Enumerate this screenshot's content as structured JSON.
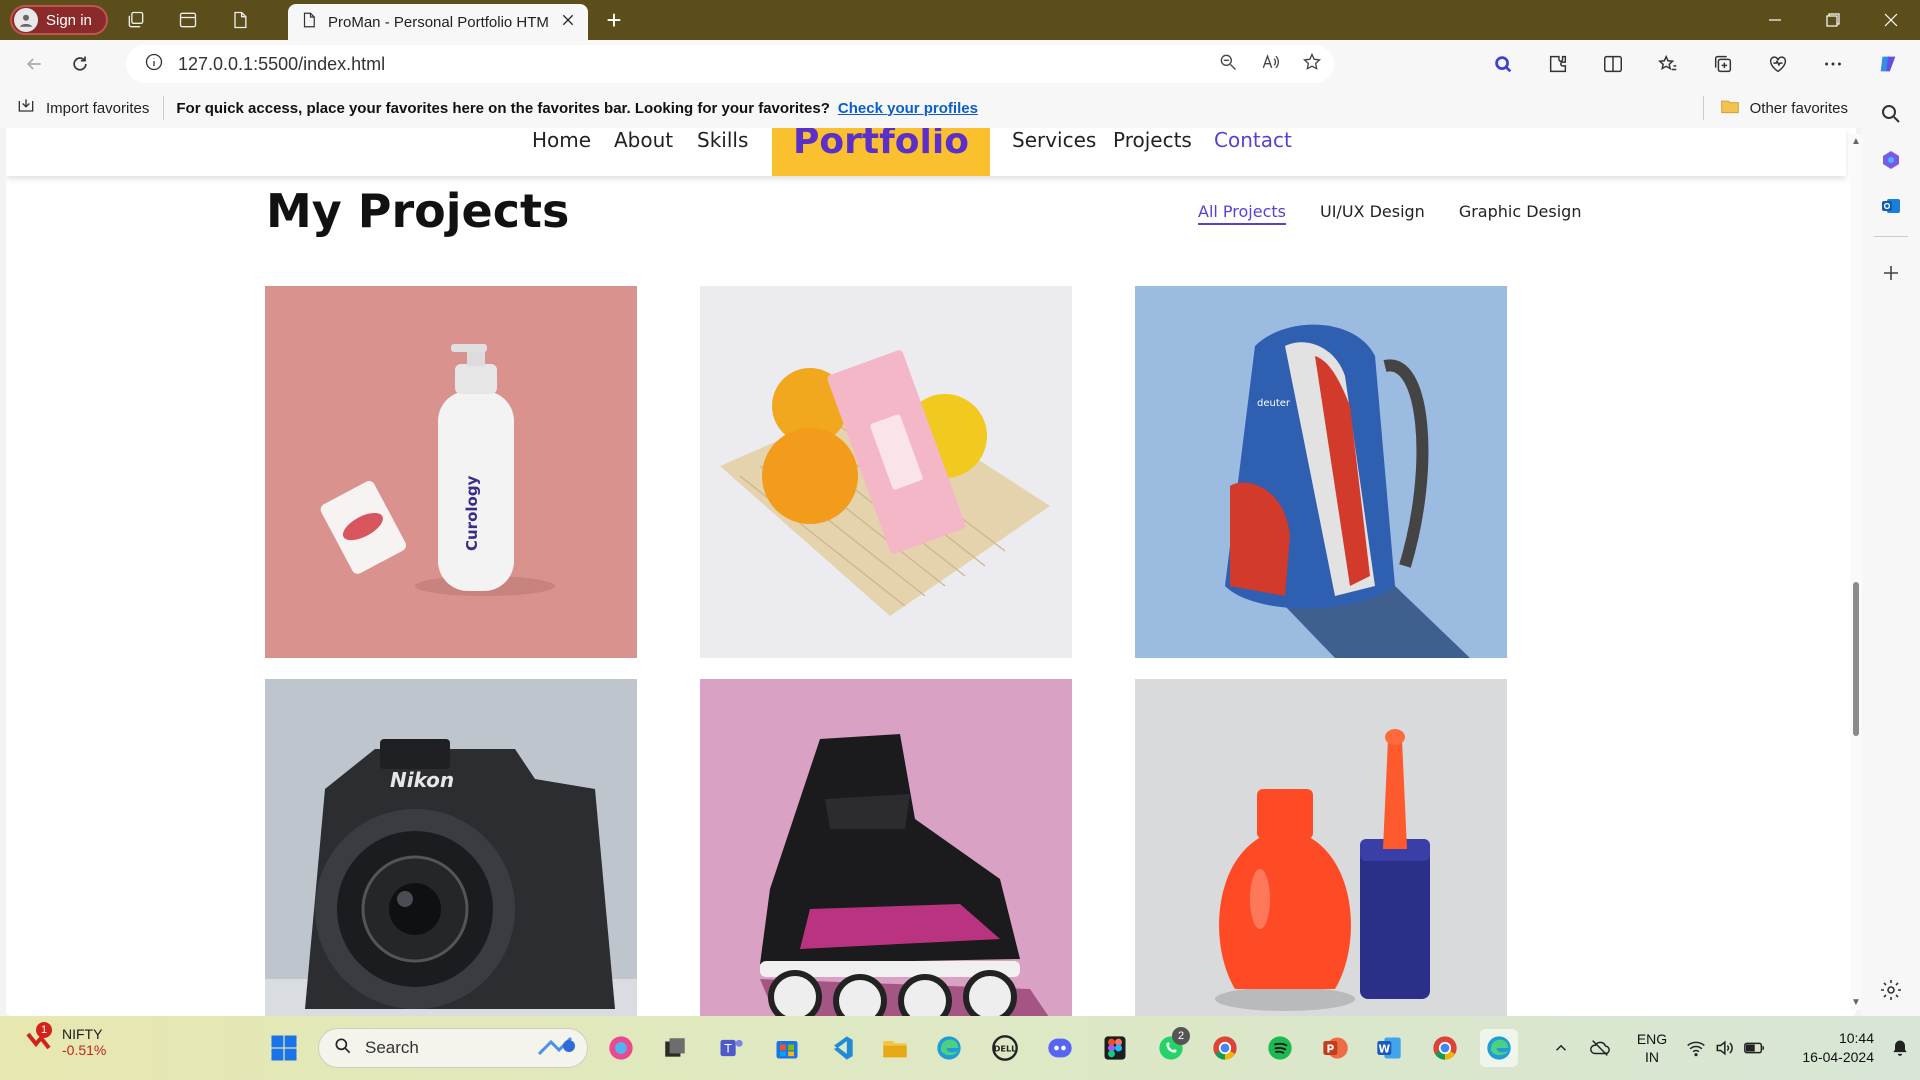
{
  "browser": {
    "signin_label": "Sign in",
    "tab_title": "ProMan - Personal Portfolio HTML",
    "url": "127.0.0.1:5500/index.html",
    "favorites_bar": {
      "import_label": "Import favorites",
      "message": "For quick access, place your favorites here on the favorites bar. Looking for your favorites?",
      "link": "Check your profiles",
      "other_label": "Other favorites"
    }
  },
  "site": {
    "nav": [
      "Home",
      "About",
      "Skills",
      "Services",
      "Projects",
      "Contact"
    ],
    "logo": "Portfolio",
    "section_title": "My Projects",
    "filters": [
      "All Projects",
      "UI/UX Design",
      "Graphic Design"
    ],
    "projects": [
      {
        "name": "Curology skincare bottle",
        "bg": "#d9928d",
        "print": "Curology"
      },
      {
        "name": "Pink box with oranges",
        "bg": "#ecebf0"
      },
      {
        "name": "Deuter backpack",
        "bg": "#9bbbe0",
        "print": "deuter"
      },
      {
        "name": "Nikon camera",
        "bg": "#bfc5cc",
        "print": "Nikon"
      },
      {
        "name": "Inline skate",
        "bg": "#d9a2c4"
      },
      {
        "name": "Nail polish bottle",
        "bg": "#d9dadc"
      }
    ]
  },
  "taskbar": {
    "ticker_name": "NIFTY",
    "ticker_value": "-0.51%",
    "ticker_badge": "1",
    "search_label": "Search",
    "whatsapp_badge": "2",
    "lang_line1": "ENG",
    "lang_line2": "IN",
    "time": "10:44",
    "date": "16-04-2024"
  },
  "colors": {
    "accent": "#5b3fd1",
    "logo_bg": "#fbc02d",
    "titlebar": "#5c4e1a"
  }
}
